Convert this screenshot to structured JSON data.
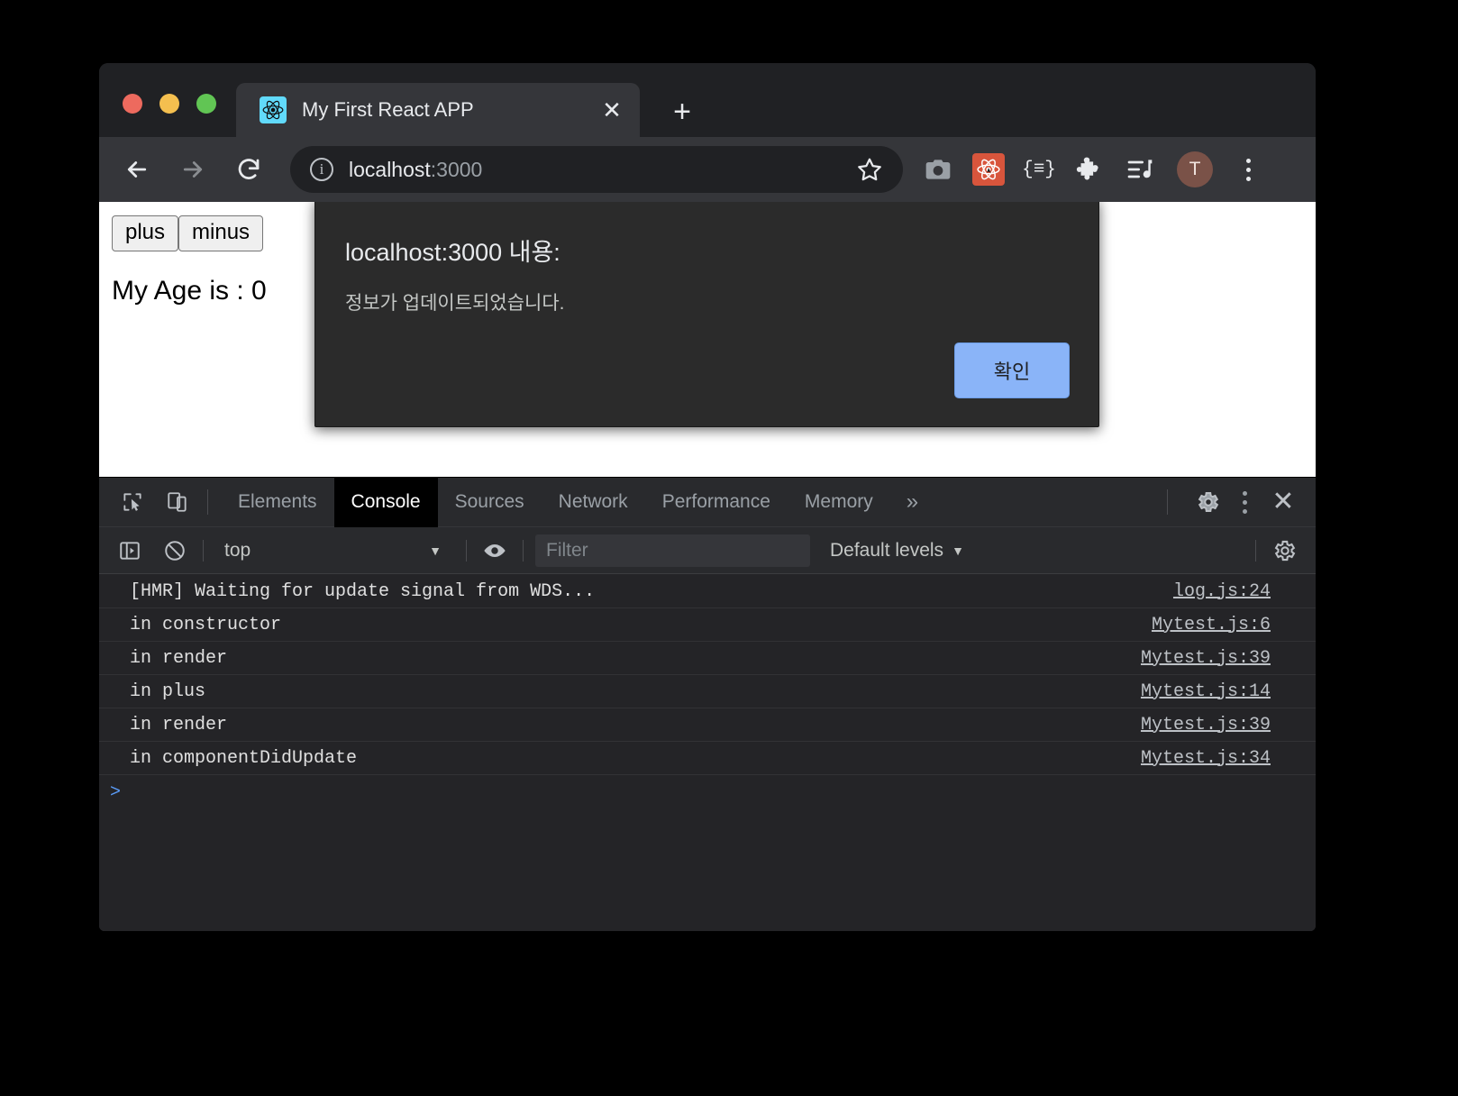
{
  "browser": {
    "tab": {
      "title": "My First React APP",
      "favicon": "react-logo-icon",
      "close_label": "✕"
    },
    "new_tab_label": "+",
    "nav": {
      "back": "back-arrow-icon",
      "forward": "forward-arrow-icon",
      "reload": "reload-icon"
    },
    "omnibox": {
      "info_label": "i",
      "host": "localhost",
      "port": ":3000",
      "star": "bookmark-star-icon"
    },
    "extensions": [
      {
        "name": "camera-icon"
      },
      {
        "name": "react-devtools-icon",
        "color": "#d8553c"
      },
      {
        "name": "json-formatter-icon",
        "label": "{≡}"
      },
      {
        "name": "puzzle-extensions-icon"
      },
      {
        "name": "media-playlist-icon"
      }
    ],
    "avatar_letter": "T",
    "menu_label": "chrome-menu-icon"
  },
  "page": {
    "buttons": [
      {
        "label": "plus"
      },
      {
        "label": "minus"
      }
    ],
    "text": "My Age is : 0"
  },
  "alert": {
    "title": "localhost:3000 내용:",
    "message": "정보가 업데이트되었습니다.",
    "ok_label": "확인",
    "button_color": "#8ab4f8"
  },
  "devtools": {
    "tabs": [
      {
        "label": "Elements",
        "active": false
      },
      {
        "label": "Console",
        "active": true
      },
      {
        "label": "Sources",
        "active": false
      },
      {
        "label": "Network",
        "active": false
      },
      {
        "label": "Performance",
        "active": false
      },
      {
        "label": "Memory",
        "active": false
      }
    ],
    "more_tabs_label": "»",
    "settings_label": "settings-gear-icon",
    "kebab_label": "more-options-icon",
    "close_label": "✕",
    "filterbar": {
      "sidebar_toggle": "console-sidebar-icon",
      "clear_label": "clear-console-icon",
      "context": "top",
      "context_caret": "▼",
      "eye_label": "live-expression-icon",
      "filter_placeholder": "Filter",
      "levels_label": "Default levels",
      "levels_caret": "▼",
      "settings_label": "console-settings-gear-icon"
    },
    "logs": [
      {
        "message": "[HMR] Waiting for update signal from WDS...",
        "source": "log.js:24"
      },
      {
        "message": "in constructor",
        "source": "Mytest.js:6"
      },
      {
        "message": "in render",
        "source": "Mytest.js:39"
      },
      {
        "message": "in plus",
        "source": "Mytest.js:14"
      },
      {
        "message": "in render",
        "source": "Mytest.js:39"
      },
      {
        "message": "in componentDidUpdate",
        "source": "Mytest.js:34"
      }
    ],
    "prompt_caret": ">"
  }
}
